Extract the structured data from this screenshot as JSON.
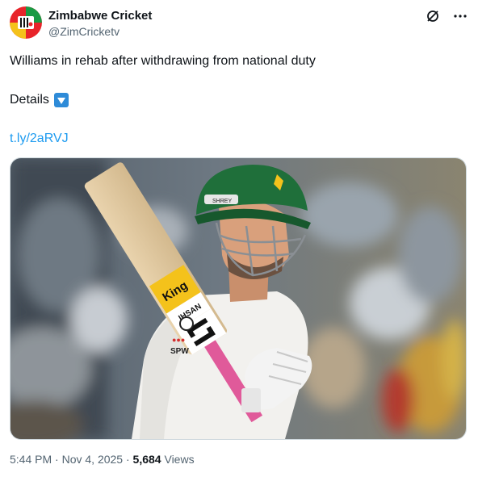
{
  "account": {
    "display_name": "Zimbabwe Cricket",
    "handle": "@ZimCricketv",
    "avatar_icon": "zimbabwe-cricket-logo"
  },
  "post": {
    "line1": "Williams in rehab after withdrawing from national duty",
    "line2": "Details",
    "emoji_icon": "down-arrow-button-emoji",
    "link_text": "t.ly/2aRVJ"
  },
  "media": {
    "helmet_sticker": "SHREY",
    "bat_sticker": "King",
    "bat_brand": "IHSAN",
    "shirt_text": "SPW"
  },
  "meta": {
    "time": "5:44 PM",
    "separator": "·",
    "date": "Nov 4, 2025",
    "views_count": "5,684",
    "views_label": "Views"
  },
  "colors": {
    "link": "#1d9bf0",
    "muted": "#536471",
    "accent": "#e8242a"
  }
}
